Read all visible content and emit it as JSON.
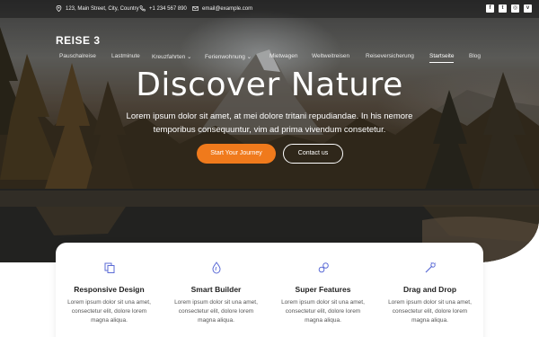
{
  "topbar": {
    "address": "123, Main Street, City, Country",
    "phone": "+1 234 567 890",
    "email": "email@example.com",
    "social_icons": [
      "facebook-icon",
      "twitter-icon",
      "instagram-icon",
      "vimeo-icon"
    ]
  },
  "brand": {
    "name": "REISE 3"
  },
  "nav": {
    "items": [
      {
        "label": "Pauschalreise"
      },
      {
        "label": "Lastminute"
      },
      {
        "label": "Kreuzfahrten"
      },
      {
        "label": "Ferienwohnung"
      },
      {
        "label": "Mietwagen"
      },
      {
        "label": "Weltweitreisen"
      },
      {
        "label": "Reiseversicherung"
      },
      {
        "label": "Startseite"
      },
      {
        "label": "Blog"
      }
    ],
    "active": "Startseite"
  },
  "hero": {
    "title": "Discover Nature",
    "subtitle": "Lorem ipsum dolor sit amet, at mei dolore tritani repudiandae. In his nemore temporibus consequuntur, vim ad prima vivendum consetetur.",
    "primary_button": "Start Your Journey",
    "secondary_button": "Contact us"
  },
  "features": [
    {
      "icon": "copy-icon",
      "title": "Responsive Design",
      "text": "Lorem ipsum dolor sit una amet, consectetur elit, dolore lorem magna aliqua."
    },
    {
      "icon": "drop-icon",
      "title": "Smart Builder",
      "text": "Lorem ipsum dolor sit una amet, consectetur elit, dolore lorem magna aliqua."
    },
    {
      "icon": "link-icon",
      "title": "Super Features",
      "text": "Lorem ipsum dolor sit una amet, consectetur elit, dolore lorem magna aliqua."
    },
    {
      "icon": "wand-icon",
      "title": "Drag and Drop",
      "text": "Lorem ipsum dolor sit una amet, consectetur elit, dolore lorem magna aliqua."
    }
  ],
  "colors": {
    "accent": "#f07a1c",
    "feature_icon": "#5b6bd6"
  }
}
